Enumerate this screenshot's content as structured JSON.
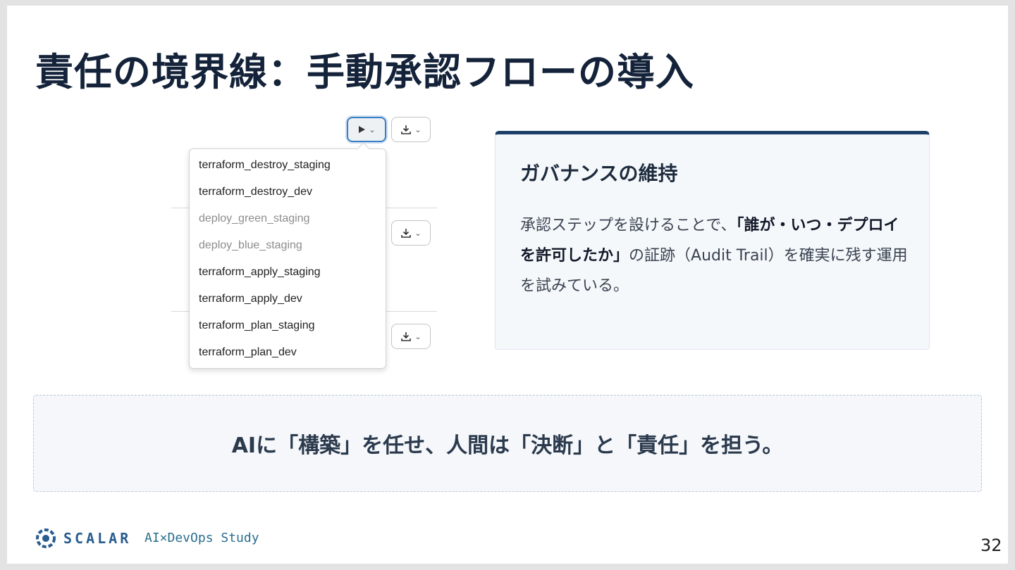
{
  "slide": {
    "title": "責任の境界線：手動承認フローの導入",
    "page_number": "32"
  },
  "screenshot": {
    "dropdown_items": [
      {
        "label": "terraform_destroy_staging",
        "disabled": false
      },
      {
        "label": "terraform_destroy_dev",
        "disabled": false
      },
      {
        "label": "deploy_green_staging",
        "disabled": true
      },
      {
        "label": "deploy_blue_staging",
        "disabled": true
      },
      {
        "label": "terraform_apply_staging",
        "disabled": false
      },
      {
        "label": "terraform_apply_dev",
        "disabled": false
      },
      {
        "label": "terraform_plan_staging",
        "disabled": false
      },
      {
        "label": "terraform_plan_dev",
        "disabled": false
      }
    ],
    "icons": {
      "run": "play-icon",
      "download": "download-icon",
      "caret": "chevron-down-icon"
    }
  },
  "card": {
    "title": "ガバナンスの維持",
    "body_before": "承認ステップを設けることで、",
    "body_bold": "「誰が・いつ・デプロイを許可したか」",
    "body_after": "の証跡（Audit Trail）を確実に残す運用を試みている。"
  },
  "banner": {
    "text": "AIに「構築」を任せ、人間は「決断」と「責任」を担う。"
  },
  "footer": {
    "logo_text": "SCALAR",
    "sub_brand": "AI×DevOps Study"
  },
  "colors": {
    "title": "#14233a",
    "card_accent": "#1b3f66",
    "brand": "#2a5d8f"
  }
}
